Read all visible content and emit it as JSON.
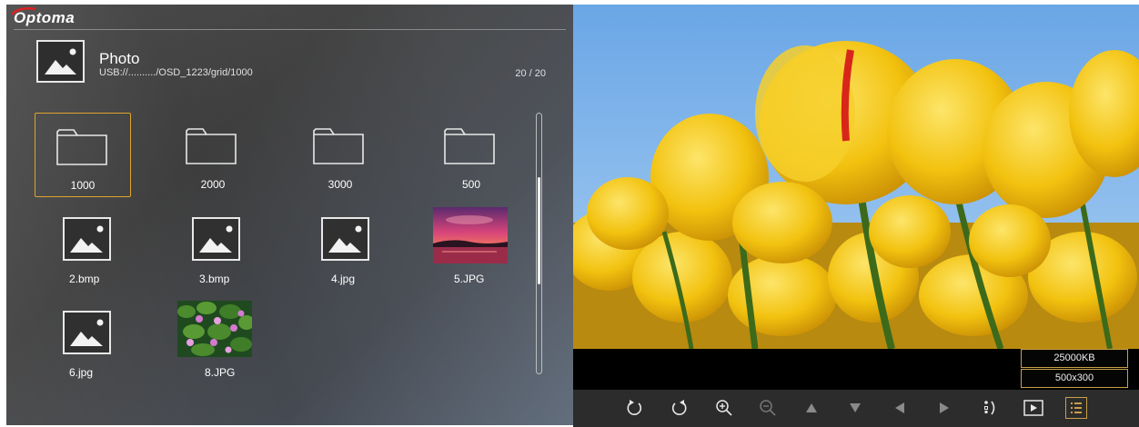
{
  "brand": {
    "name": "Optoma",
    "accent_color": "#e02020"
  },
  "header": {
    "title": "Photo",
    "path": "USB://........../OSD_1223/grid/1000",
    "page_count": "20 / 20",
    "icon": "image-icon"
  },
  "grid": {
    "items": [
      {
        "label": "1000",
        "type": "folder",
        "icon": "folder-icon",
        "selected": true
      },
      {
        "label": "2000",
        "type": "folder",
        "icon": "folder-icon"
      },
      {
        "label": "3000",
        "type": "folder",
        "icon": "folder-icon"
      },
      {
        "label": "500",
        "type": "folder",
        "icon": "folder-icon"
      },
      {
        "label": "2.bmp",
        "type": "image",
        "icon": "image-icon"
      },
      {
        "label": "3.bmp",
        "type": "image",
        "icon": "image-icon"
      },
      {
        "label": "4.jpg",
        "type": "image",
        "icon": "image-icon"
      },
      {
        "label": "5.JPG",
        "type": "image",
        "icon": "sunset-thumbnail"
      },
      {
        "label": "6.jpg",
        "type": "image",
        "icon": "image-icon"
      },
      {
        "label": "8.JPG",
        "type": "image",
        "icon": "flowers-thumbnail"
      }
    ],
    "scroll_position": 0.25
  },
  "preview": {
    "file_size": "25000KB",
    "resolution": "500x300"
  },
  "controls": [
    {
      "icon": "rotate-left-icon"
    },
    {
      "icon": "rotate-right-icon"
    },
    {
      "icon": "zoom-in-icon"
    },
    {
      "icon": "zoom-out-icon"
    },
    {
      "icon": "pan-up-icon"
    },
    {
      "icon": "pan-down-icon"
    },
    {
      "icon": "pan-left-icon"
    },
    {
      "icon": "pan-right-icon"
    },
    {
      "icon": "swap-icon"
    },
    {
      "icon": "slideshow-icon"
    },
    {
      "icon": "info-list-icon",
      "active": true
    }
  ],
  "colors": {
    "selection": "#e0a32e",
    "panel": "#444444",
    "sky": "#7fb3e8",
    "tulip": "#f2c20f"
  }
}
